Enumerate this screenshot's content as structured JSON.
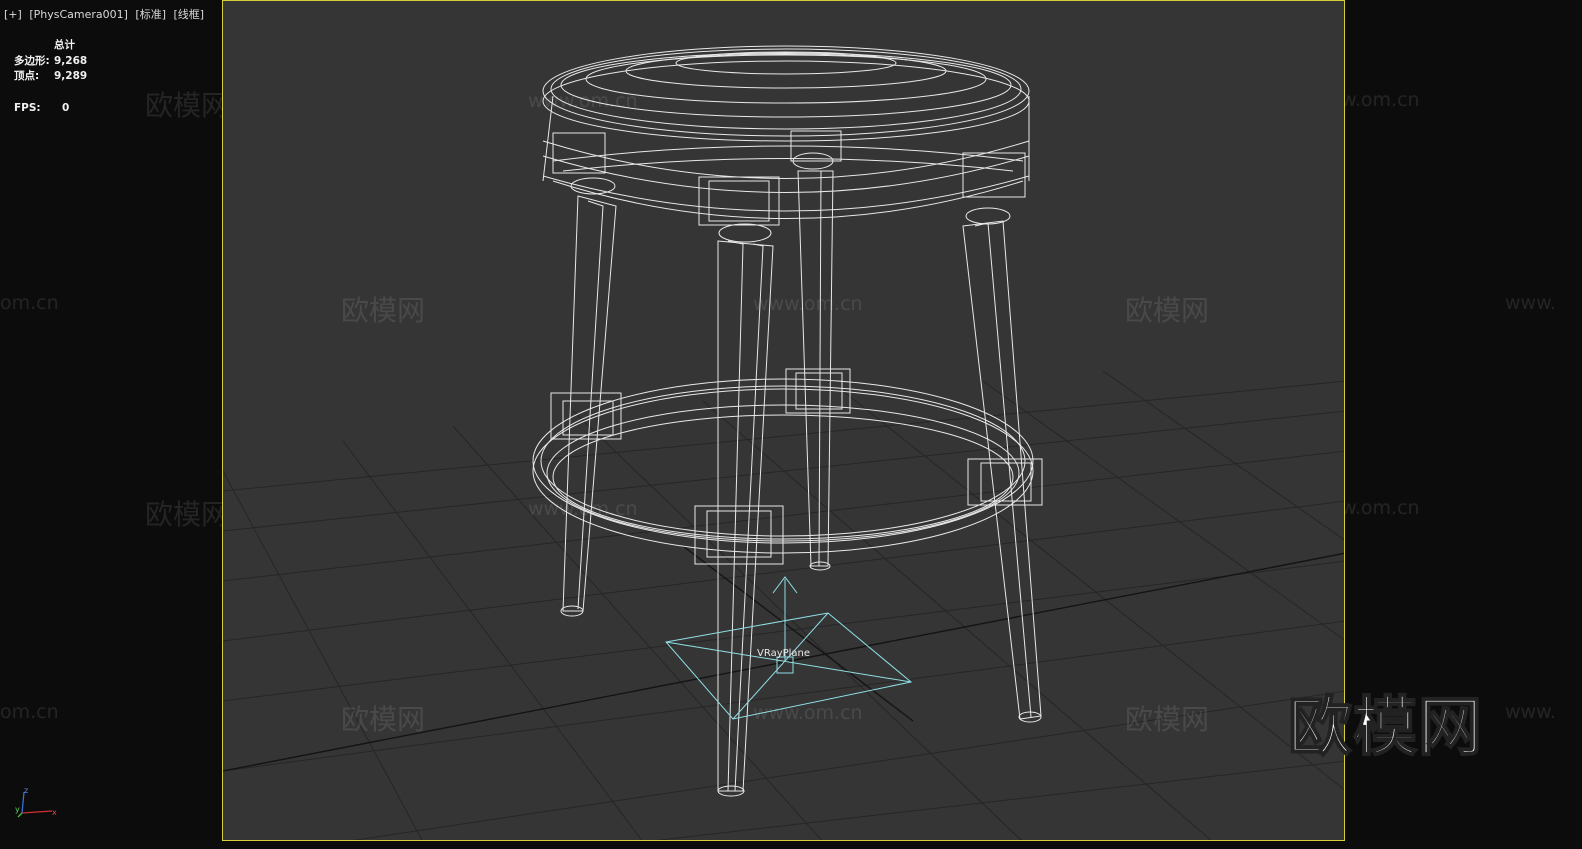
{
  "viewport": {
    "labels": [
      "[+]",
      "[PhysCamera001]",
      "[标准]",
      "[线框]"
    ]
  },
  "stats": {
    "title": "总计",
    "polygons_label": "多边形:",
    "polygons_value": "9,268",
    "vertices_label": "顶点:",
    "vertices_value": "9,289",
    "fps_label": "FPS:",
    "fps_value": "0"
  },
  "scene": {
    "object_label": "VRayPlane",
    "grid_color": "#2a2a2a",
    "wire_color": "#e8e8e8",
    "plane_color": "#8fe0e6",
    "border_color": "#d6cf3a"
  },
  "watermarks": {
    "logo_text": "欧模网",
    "url_text": "www.om.cn",
    "url_short": "om.cn",
    "url_prefix": "www."
  },
  "axis": {
    "x": "x",
    "y": "y",
    "z": "z"
  }
}
